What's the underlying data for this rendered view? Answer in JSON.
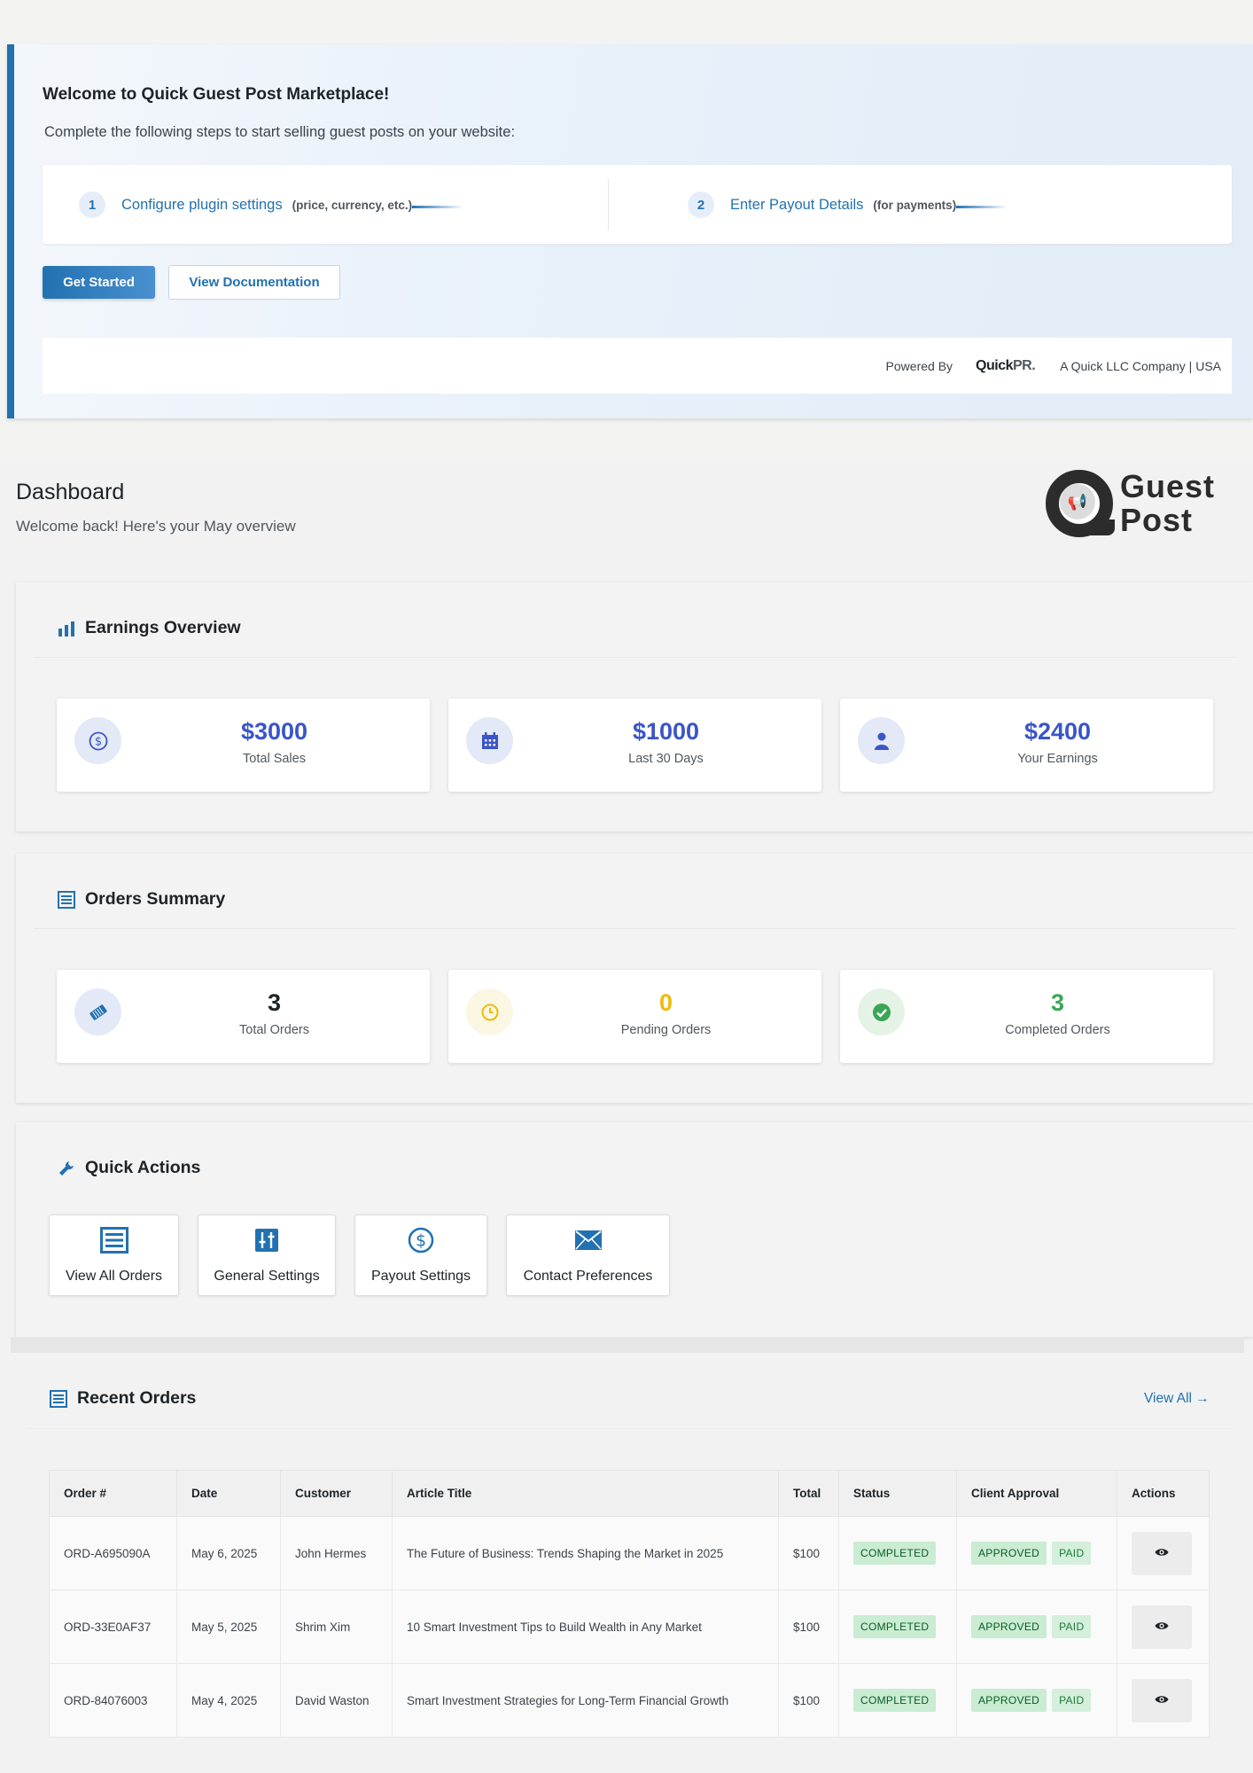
{
  "welcome": {
    "title": "Welcome to Quick Guest Post Marketplace!",
    "subtitle": "Complete the following steps to start selling guest posts on your website:",
    "steps": [
      {
        "num": "1",
        "link": "Configure plugin settings",
        "note": "(price, currency, etc.)"
      },
      {
        "num": "2",
        "link": "Enter Payout Details",
        "note": "(for payments)"
      }
    ],
    "primary_button": "Get Started",
    "secondary_button": "View Documentation",
    "powered_by": "Powered By",
    "logo_main": "Quick",
    "logo_suffix": "PR.",
    "company": "A Quick LLC Company | USA"
  },
  "dashboard": {
    "title": "Dashboard",
    "subtitle": "Welcome back! Here's your May overview",
    "logo_line1": "Guest",
    "logo_line2": "Post"
  },
  "earnings": {
    "title": "Earnings Overview",
    "cards": [
      {
        "value": "$3000",
        "label": "Total Sales",
        "icon": "dollar-circle-icon"
      },
      {
        "value": "$1000",
        "label": "Last 30 Days",
        "icon": "calendar-icon"
      },
      {
        "value": "$2400",
        "label": "Your Earnings",
        "icon": "user-icon"
      }
    ]
  },
  "orders_summary": {
    "title": "Orders Summary",
    "cards": [
      {
        "value": "3",
        "label": "Total Orders",
        "icon": "ticket-icon",
        "color": "#1d2327"
      },
      {
        "value": "0",
        "label": "Pending Orders",
        "icon": "clock-icon",
        "color": "#f0b90b"
      },
      {
        "value": "3",
        "label": "Completed Orders",
        "icon": "check-circle-icon",
        "color": "#3aa655"
      }
    ]
  },
  "quick_actions": {
    "title": "Quick Actions",
    "buttons": [
      {
        "label": "View All Orders",
        "icon": "list-icon"
      },
      {
        "label": "General Settings",
        "icon": "sliders-icon"
      },
      {
        "label": "Payout Settings",
        "icon": "dollar-circle-icon"
      },
      {
        "label": "Contact Preferences",
        "icon": "envelope-icon"
      }
    ]
  },
  "recent_orders": {
    "title": "Recent Orders",
    "view_all": "View All →",
    "columns": [
      "Order #",
      "Date",
      "Customer",
      "Article Title",
      "Total",
      "Status",
      "Client Approval",
      "Actions"
    ],
    "rows": [
      {
        "order": "ORD-A695090A",
        "date": "May 6, 2025",
        "customer": "John Hermes",
        "title": "The Future of Business: Trends Shaping the Market in 2025",
        "total": "$100",
        "status": "COMPLETED",
        "approval": "APPROVED",
        "paid": "PAID"
      },
      {
        "order": "ORD-33E0AF37",
        "date": "May 5, 2025",
        "customer": "Shrim Xim",
        "title": "10 Smart Investment Tips to Build Wealth in Any Market",
        "total": "$100",
        "status": "COMPLETED",
        "approval": "APPROVED",
        "paid": "PAID"
      },
      {
        "order": "ORD-84076003",
        "date": "May 4, 2025",
        "customer": "David Waston",
        "title": "Smart Investment Strategies for Long-Term Financial Growth",
        "total": "$100",
        "status": "COMPLETED",
        "approval": "APPROVED",
        "paid": "PAID"
      }
    ]
  },
  "colors": {
    "accent": "#2271b1",
    "stat_blue": "#3a55c8",
    "pending": "#f0b90b",
    "success": "#3aa655"
  }
}
